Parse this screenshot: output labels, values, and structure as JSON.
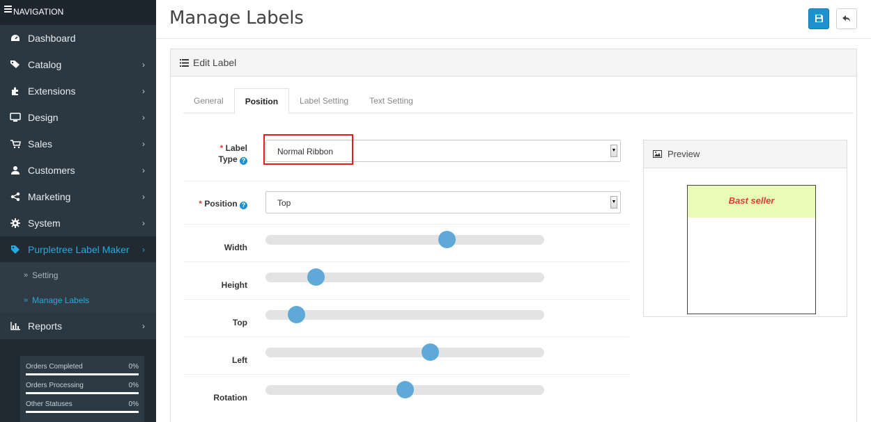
{
  "sidebar": {
    "header": "NAVIGATION",
    "items": [
      {
        "label": "Dashboard",
        "icon": "dashboard-icon"
      },
      {
        "label": "Catalog",
        "icon": "tags-icon"
      },
      {
        "label": "Extensions",
        "icon": "puzzle-icon"
      },
      {
        "label": "Design",
        "icon": "monitor-icon"
      },
      {
        "label": "Sales",
        "icon": "cart-icon"
      },
      {
        "label": "Customers",
        "icon": "user-icon"
      },
      {
        "label": "Marketing",
        "icon": "share-icon"
      },
      {
        "label": "System",
        "icon": "gear-icon"
      },
      {
        "label": "Purpletree Label Maker",
        "icon": "tag-icon"
      }
    ],
    "submenu": [
      {
        "label": "Setting"
      },
      {
        "label": "Manage Labels"
      }
    ],
    "reports": {
      "label": "Reports",
      "icon": "bar-chart-icon"
    },
    "stats": [
      {
        "label": "Orders Completed",
        "value": "0%"
      },
      {
        "label": "Orders Processing",
        "value": "0%"
      },
      {
        "label": "Other Statuses",
        "value": "0%"
      }
    ]
  },
  "page": {
    "title": "Manage Labels",
    "panel_title": "Edit Label"
  },
  "tabs": [
    "General",
    "Position",
    "Label Setting",
    "Text Setting"
  ],
  "form": {
    "label_type": {
      "label_line1": "Label",
      "label_line2": "Type",
      "value": "Normal Ribbon"
    },
    "position": {
      "label": "Position",
      "value": "Top"
    },
    "sliders": [
      {
        "label": "Width",
        "value_percent": 65
      },
      {
        "label": "Height",
        "value_percent": 18
      },
      {
        "label": "Top",
        "value_percent": 11
      },
      {
        "label": "Left",
        "value_percent": 59
      },
      {
        "label": "Rotation",
        "value_percent": 50
      }
    ]
  },
  "preview": {
    "title": "Preview",
    "ribbon_text": "Bast seller"
  },
  "colors": {
    "accent": "#1e91cf",
    "sidebar_bg": "#2b3841",
    "ribbon_bg": "#e8fcb8",
    "ribbon_text": "#e53935",
    "highlight": "#e31b1b"
  }
}
